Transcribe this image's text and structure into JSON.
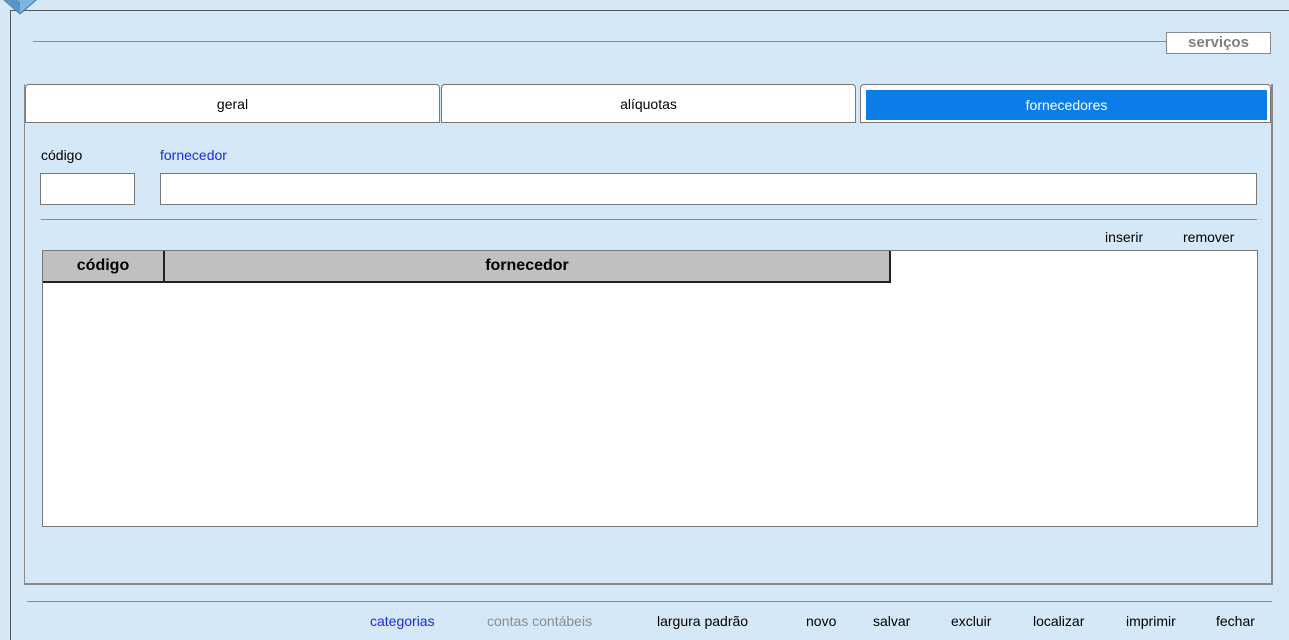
{
  "form": {
    "title": "serviços"
  },
  "tabs": [
    {
      "label": "geral",
      "active": false
    },
    {
      "label": "alíquotas",
      "active": false
    },
    {
      "label": "fornecedores",
      "active": true
    }
  ],
  "fields": {
    "codigo_label": "código",
    "codigo_value": "",
    "fornecedor_label": "fornecedor",
    "fornecedor_value": ""
  },
  "grid_actions": {
    "inserir": "inserir",
    "remover": "remover"
  },
  "grid": {
    "columns": [
      "código",
      "fornecedor"
    ],
    "rows": []
  },
  "footer_menu": {
    "categorias": "categorias",
    "contas_contabeis": "contas contábeis",
    "largura_padrao": "largura padrão",
    "novo": "novo",
    "salvar": "salvar",
    "excluir": "excluir",
    "localizar": "localizar",
    "imprimir": "imprimir",
    "fechar": "fechar"
  },
  "colors": {
    "background": "#d4e8f8",
    "accent_line": "#2bb5b8",
    "active_tab": "#0a7de8",
    "link_blue": "#1c2ae0",
    "disabled_gray": "#8c8c8c"
  },
  "icons": {
    "logo": "app-logo-icon"
  }
}
